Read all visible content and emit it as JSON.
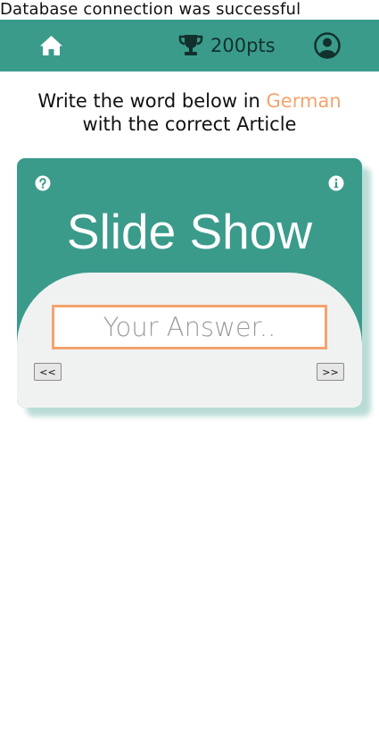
{
  "status": {
    "message": "Database connection was successful"
  },
  "header": {
    "home_icon": "home-icon",
    "trophy_icon": "trophy-icon",
    "score": "200pts",
    "profile_icon": "user-circle-icon"
  },
  "instruction": {
    "prefix": "Write the word below in ",
    "language": "German",
    "suffix": "with the correct Article"
  },
  "card": {
    "title": "Slide Show",
    "help_icon": "question-circle-icon",
    "info_icon": "info-circle-icon",
    "answer_placeholder": "Your Answer..",
    "answer_value": "",
    "prev_label": "<<",
    "next_label": ">>"
  },
  "colors": {
    "primary": "#3a9b8b",
    "accent": "#f5a36e",
    "panel": "#f0f2f1",
    "dark_icon": "#12312c"
  }
}
